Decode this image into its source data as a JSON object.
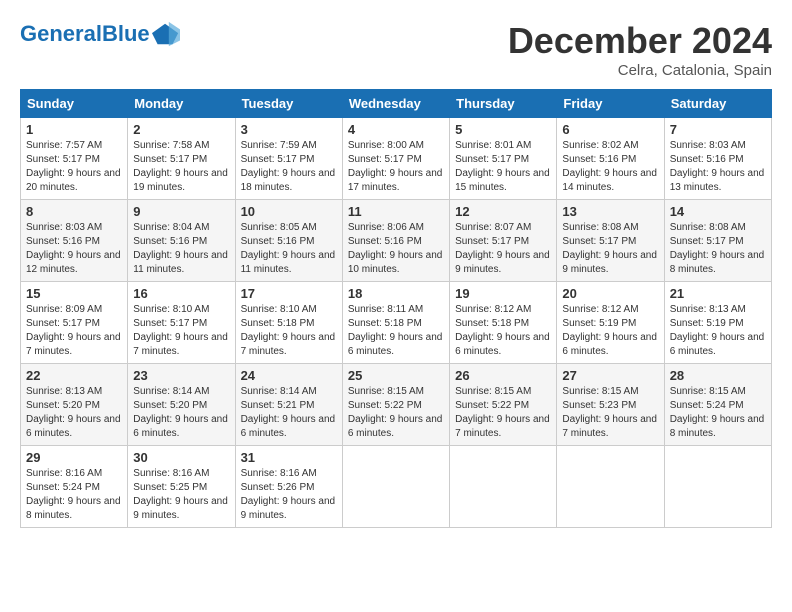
{
  "header": {
    "logo_general": "General",
    "logo_blue": "Blue",
    "month_title": "December 2024",
    "location": "Celra, Catalonia, Spain"
  },
  "days_of_week": [
    "Sunday",
    "Monday",
    "Tuesday",
    "Wednesday",
    "Thursday",
    "Friday",
    "Saturday"
  ],
  "weeks": [
    [
      {
        "day": "1",
        "sunrise": "7:57 AM",
        "sunset": "5:17 PM",
        "daylight": "9 hours and 20 minutes."
      },
      {
        "day": "2",
        "sunrise": "7:58 AM",
        "sunset": "5:17 PM",
        "daylight": "9 hours and 19 minutes."
      },
      {
        "day": "3",
        "sunrise": "7:59 AM",
        "sunset": "5:17 PM",
        "daylight": "9 hours and 18 minutes."
      },
      {
        "day": "4",
        "sunrise": "8:00 AM",
        "sunset": "5:17 PM",
        "daylight": "9 hours and 17 minutes."
      },
      {
        "day": "5",
        "sunrise": "8:01 AM",
        "sunset": "5:17 PM",
        "daylight": "9 hours and 15 minutes."
      },
      {
        "day": "6",
        "sunrise": "8:02 AM",
        "sunset": "5:16 PM",
        "daylight": "9 hours and 14 minutes."
      },
      {
        "day": "7",
        "sunrise": "8:03 AM",
        "sunset": "5:16 PM",
        "daylight": "9 hours and 13 minutes."
      }
    ],
    [
      {
        "day": "8",
        "sunrise": "8:03 AM",
        "sunset": "5:16 PM",
        "daylight": "9 hours and 12 minutes."
      },
      {
        "day": "9",
        "sunrise": "8:04 AM",
        "sunset": "5:16 PM",
        "daylight": "9 hours and 11 minutes."
      },
      {
        "day": "10",
        "sunrise": "8:05 AM",
        "sunset": "5:16 PM",
        "daylight": "9 hours and 11 minutes."
      },
      {
        "day": "11",
        "sunrise": "8:06 AM",
        "sunset": "5:16 PM",
        "daylight": "9 hours and 10 minutes."
      },
      {
        "day": "12",
        "sunrise": "8:07 AM",
        "sunset": "5:17 PM",
        "daylight": "9 hours and 9 minutes."
      },
      {
        "day": "13",
        "sunrise": "8:08 AM",
        "sunset": "5:17 PM",
        "daylight": "9 hours and 9 minutes."
      },
      {
        "day": "14",
        "sunrise": "8:08 AM",
        "sunset": "5:17 PM",
        "daylight": "9 hours and 8 minutes."
      }
    ],
    [
      {
        "day": "15",
        "sunrise": "8:09 AM",
        "sunset": "5:17 PM",
        "daylight": "9 hours and 7 minutes."
      },
      {
        "day": "16",
        "sunrise": "8:10 AM",
        "sunset": "5:17 PM",
        "daylight": "9 hours and 7 minutes."
      },
      {
        "day": "17",
        "sunrise": "8:10 AM",
        "sunset": "5:18 PM",
        "daylight": "9 hours and 7 minutes."
      },
      {
        "day": "18",
        "sunrise": "8:11 AM",
        "sunset": "5:18 PM",
        "daylight": "9 hours and 6 minutes."
      },
      {
        "day": "19",
        "sunrise": "8:12 AM",
        "sunset": "5:18 PM",
        "daylight": "9 hours and 6 minutes."
      },
      {
        "day": "20",
        "sunrise": "8:12 AM",
        "sunset": "5:19 PM",
        "daylight": "9 hours and 6 minutes."
      },
      {
        "day": "21",
        "sunrise": "8:13 AM",
        "sunset": "5:19 PM",
        "daylight": "9 hours and 6 minutes."
      }
    ],
    [
      {
        "day": "22",
        "sunrise": "8:13 AM",
        "sunset": "5:20 PM",
        "daylight": "9 hours and 6 minutes."
      },
      {
        "day": "23",
        "sunrise": "8:14 AM",
        "sunset": "5:20 PM",
        "daylight": "9 hours and 6 minutes."
      },
      {
        "day": "24",
        "sunrise": "8:14 AM",
        "sunset": "5:21 PM",
        "daylight": "9 hours and 6 minutes."
      },
      {
        "day": "25",
        "sunrise": "8:15 AM",
        "sunset": "5:22 PM",
        "daylight": "9 hours and 6 minutes."
      },
      {
        "day": "26",
        "sunrise": "8:15 AM",
        "sunset": "5:22 PM",
        "daylight": "9 hours and 7 minutes."
      },
      {
        "day": "27",
        "sunrise": "8:15 AM",
        "sunset": "5:23 PM",
        "daylight": "9 hours and 7 minutes."
      },
      {
        "day": "28",
        "sunrise": "8:15 AM",
        "sunset": "5:24 PM",
        "daylight": "9 hours and 8 minutes."
      }
    ],
    [
      {
        "day": "29",
        "sunrise": "8:16 AM",
        "sunset": "5:24 PM",
        "daylight": "9 hours and 8 minutes."
      },
      {
        "day": "30",
        "sunrise": "8:16 AM",
        "sunset": "5:25 PM",
        "daylight": "9 hours and 9 minutes."
      },
      {
        "day": "31",
        "sunrise": "8:16 AM",
        "sunset": "5:26 PM",
        "daylight": "9 hours and 9 minutes."
      },
      null,
      null,
      null,
      null
    ]
  ],
  "labels": {
    "sunrise": "Sunrise:",
    "sunset": "Sunset:",
    "daylight": "Daylight:"
  }
}
